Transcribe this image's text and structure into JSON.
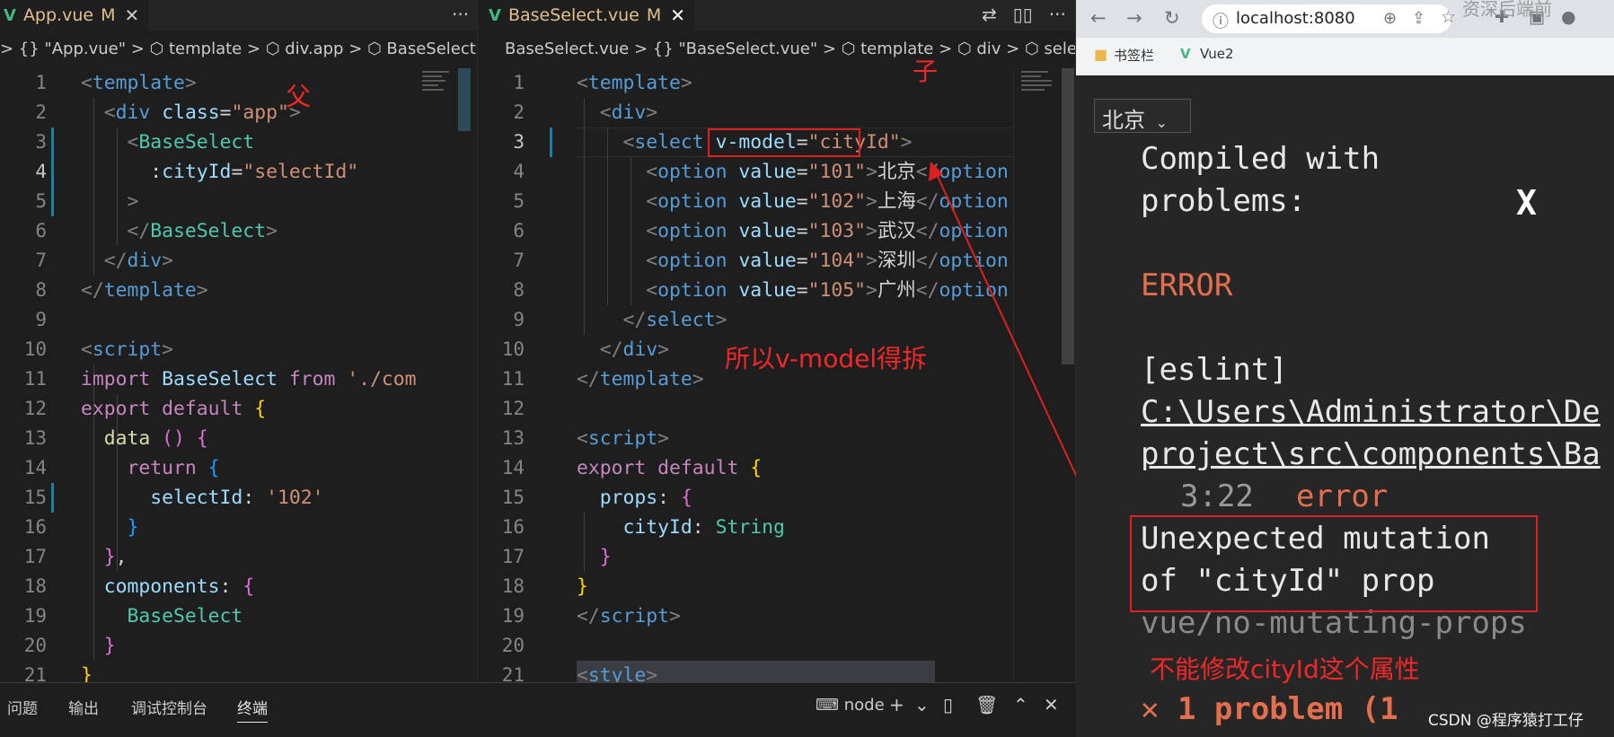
{
  "editor1": {
    "tab": {
      "name": "App.vue",
      "modified": "M",
      "close": "✕"
    },
    "more": "···",
    "breadcrumb": ">  {} \"App.vue\"  >  ⬡ template  >  ⬡ div.app  >  ⬡ BaseSelect",
    "line_numbers": [
      "1",
      "2",
      "3",
      "4",
      "5",
      "6",
      "7",
      "8",
      "9",
      "10",
      "11",
      "12",
      "13",
      "14",
      "15",
      "16",
      "17",
      "18",
      "19",
      "20",
      "21"
    ],
    "annotation_parent": "父"
  },
  "editor2": {
    "tab": {
      "name": "BaseSelect.vue",
      "modified": "M",
      "close": "✕"
    },
    "actions": [
      "⇄",
      "▯▯",
      "···"
    ],
    "breadcrumb": "BaseSelect.vue  >  {} \"BaseSelect.vue\"  >  ⬡ template  >  ⬡ div  >  ⬡ select",
    "line_numbers": [
      "1",
      "2",
      "3",
      "4",
      "5",
      "6",
      "7",
      "8",
      "9",
      "10",
      "11",
      "12",
      "13",
      "14",
      "15",
      "16",
      "17",
      "18",
      "19",
      "20",
      "21"
    ],
    "annotation_child": "子",
    "annotation_note": "所以v-model得拆"
  },
  "panel": {
    "tabs": [
      "问题",
      "输出",
      "调试控制台",
      "终端"
    ],
    "active_tab": "终端",
    "terminal_name": "node",
    "actions": [
      "+",
      "⌄",
      "▯",
      "🗑",
      "⌃",
      "✕"
    ]
  },
  "browser": {
    "url": "localhost:8080",
    "watermark_top": "资深后端前",
    "bookmarks": [
      "书签栏",
      "Vue2"
    ],
    "select_value": "北京",
    "overlay": {
      "heading_line1": "Compiled with",
      "heading_line2": "problems:",
      "close": "X",
      "error_label": "ERROR",
      "eslint": "[eslint]",
      "path_line1": "C:\\Users\\Administrator\\De",
      "path_line2": "project\\src\\components\\Ba",
      "position": "3:22",
      "severity": "error",
      "message_line1": "Unexpected mutation",
      "message_line2": "of \"cityId\" prop",
      "rule": "vue/no-mutating-props",
      "annotation": "不能修改cityId这个属性",
      "problems": "✕ 1 problem (1",
      "watermark": "CSDN @程序猿打工仔"
    }
  },
  "colors": {
    "annotation_red": "#e02020",
    "vue_green": "#41b883",
    "error_orange": "#e36f4e"
  }
}
